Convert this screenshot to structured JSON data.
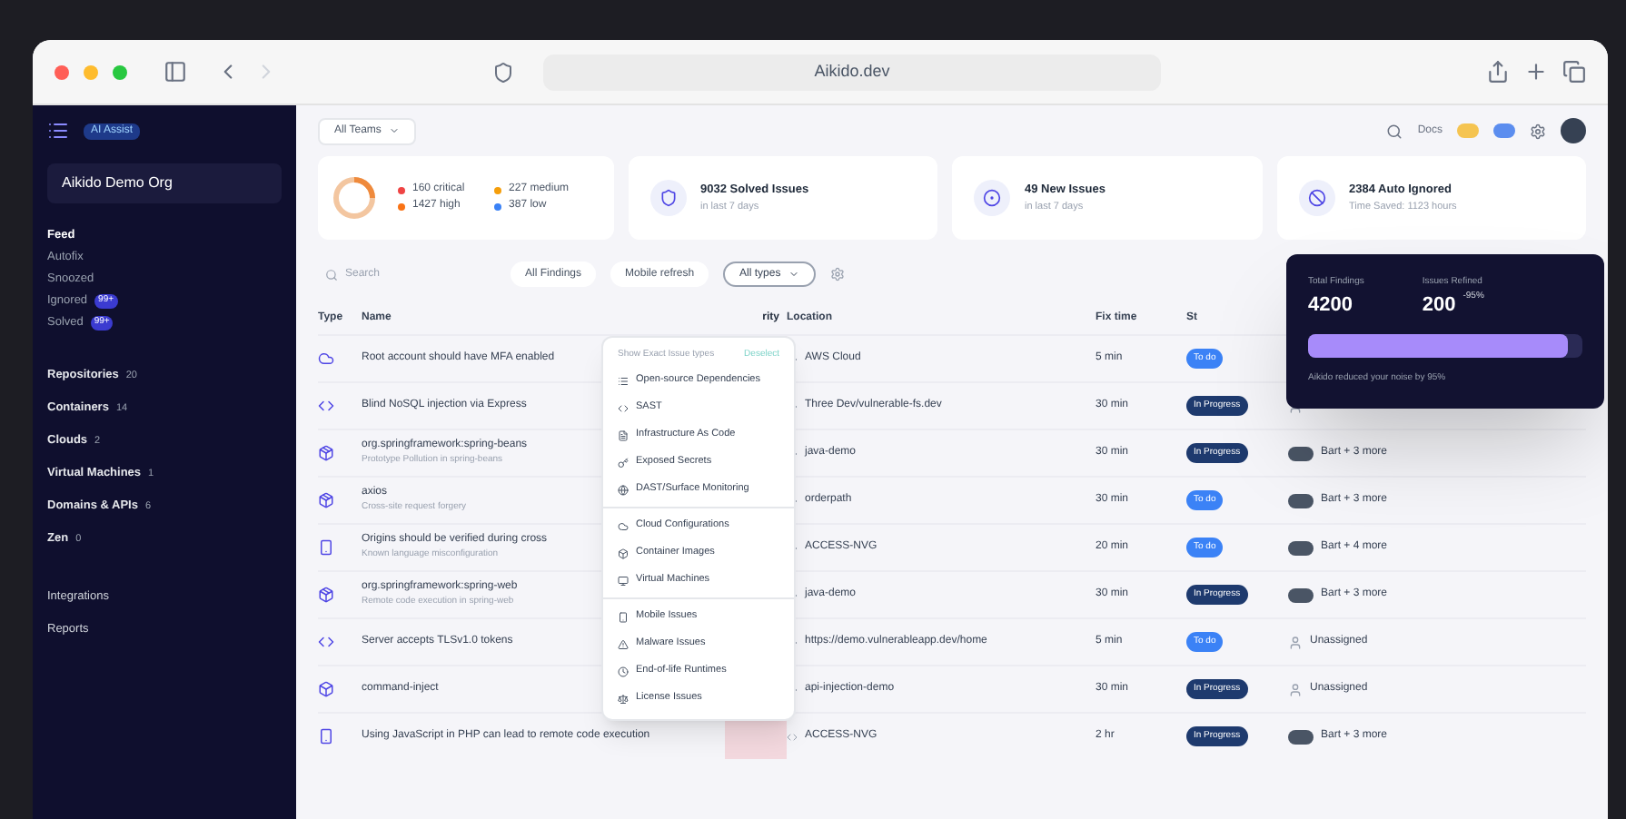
{
  "browser": {
    "address": "Aikido.dev"
  },
  "sidebar": {
    "badge": "AI Assist",
    "org": "Aikido Demo Org",
    "feed": [
      {
        "label": "Feed",
        "selected": true
      },
      {
        "label": "Autofix",
        "selected": false
      },
      {
        "label": "Snoozed",
        "selected": false
      },
      {
        "label": "Ignored",
        "selected": false,
        "count": "99+"
      },
      {
        "label": "Solved",
        "selected": false,
        "count": "99+"
      }
    ],
    "assets": [
      {
        "label": "Repositories",
        "count": "20"
      },
      {
        "label": "Containers",
        "count": "14"
      },
      {
        "label": "Clouds",
        "count": "2"
      },
      {
        "label": "Virtual Machines",
        "count": "1"
      },
      {
        "label": "Domains & APIs",
        "count": "6"
      },
      {
        "label": "Zen",
        "count": "0"
      }
    ],
    "footer": [
      {
        "label": "Integrations"
      },
      {
        "label": "Reports"
      }
    ]
  },
  "header": {
    "team": "All Teams",
    "docs": "Docs"
  },
  "stats": {
    "severities": [
      {
        "label": "160 critical",
        "color": "#ef4444"
      },
      {
        "label": "227 medium",
        "color": "#f59e0b"
      },
      {
        "label": "1427 high",
        "color": "#f97316"
      },
      {
        "label": "387 low",
        "color": "#3b82f6"
      }
    ],
    "cards": [
      {
        "kind": "solved",
        "title": "9032 Solved Issues",
        "subtitle": "in last 7 days"
      },
      {
        "kind": "new",
        "title": "49 New Issues",
        "subtitle": "in last 7 days"
      },
      {
        "kind": "ignored",
        "title": "2384 Auto Ignored",
        "subtitle": "Time Saved: 1123 hours"
      }
    ]
  },
  "filters": {
    "search_placeholder": "Search",
    "chips": [
      {
        "label": "All Findings",
        "selected": false
      },
      {
        "label": "Mobile refresh",
        "selected": false
      },
      {
        "label": "All types",
        "selected": true
      }
    ]
  },
  "table": {
    "columns": [
      "Type",
      "Name",
      "rity",
      "Location",
      "Fix time",
      "St"
    ],
    "rows": [
      {
        "kind": "cloud",
        "name": "Root account should have MFA enabled",
        "location": "AWS Cloud",
        "fix_time": "5 min",
        "status": {
          "kind": "todo",
          "label": "To do"
        },
        "assignee": {
          "kind": "none"
        }
      },
      {
        "kind": "code",
        "name": "Blind NoSQL injection via Express",
        "location": "Three Dev/vulnerable-fs.dev",
        "fix_time": "30 min",
        "status": {
          "kind": "progress",
          "label": "In Progress"
        },
        "assignee": {
          "kind": "none"
        }
      },
      {
        "kind": "dependency",
        "name": "org.springframework:spring-beans",
        "subtitle": "Prototype Pollution in spring-beans",
        "location": "java-demo",
        "fix_time": "30 min",
        "status": {
          "kind": "progress",
          "label": "In Progress"
        },
        "assignee": {
          "kind": "people",
          "label": "Bart + 3 more"
        }
      },
      {
        "kind": "dependency",
        "name": "axios",
        "subtitle": "Cross-site request forgery",
        "location": "orderpath",
        "fix_time": "30 min",
        "status": {
          "kind": "todo",
          "label": "To do"
        },
        "assignee": {
          "kind": "people",
          "label": "Bart + 3 more"
        }
      },
      {
        "kind": "mobile",
        "name": "Origins should be verified during cross",
        "subtitle": "Known language misconfiguration",
        "location": "ACCESS-NVG",
        "fix_time": "20 min",
        "status": {
          "kind": "todo",
          "label": "To do"
        },
        "assignee": {
          "kind": "people",
          "label": "Bart + 4 more"
        }
      },
      {
        "kind": "dependency",
        "name": "org.springframework:spring-web",
        "subtitle": "Remote code execution in spring-web",
        "location": "java-demo",
        "fix_time": "30 min",
        "status": {
          "kind": "progress",
          "label": "In Progress"
        },
        "assignee": {
          "kind": "people",
          "label": "Bart + 3 more"
        }
      },
      {
        "kind": "code",
        "name": "Server accepts TLSv1.0 tokens",
        "location": "https://demo.vulnerableapp.dev/home",
        "fix_time": "5 min",
        "status": {
          "kind": "todo",
          "label": "To do"
        },
        "assignee": {
          "kind": "none",
          "label": "Unassigned"
        }
      },
      {
        "kind": "container",
        "name": "command-inject",
        "location": "api-injection-demo",
        "fix_time": "30 min",
        "status": {
          "kind": "progress",
          "label": "In Progress"
        },
        "assignee": {
          "kind": "none",
          "label": "Unassigned"
        }
      },
      {
        "kind": "mobile",
        "name": "Using JavaScript in PHP can lead to remote code execution",
        "location": "ACCESS-NVG",
        "fix_time": "2 hr",
        "status": {
          "kind": "progress",
          "label": "In Progress"
        },
        "assignee": {
          "kind": "people",
          "label": "Bart + 3 more"
        }
      }
    ]
  },
  "type_menu": {
    "title": "Show Exact Issue types",
    "action": "Deselect",
    "groups": [
      [
        "Open-source Dependencies",
        "SAST",
        "Infrastructure As Code",
        "Exposed Secrets",
        "DAST/Surface Monitoring"
      ],
      [
        "Cloud Configurations",
        "Container Images",
        "Virtual Machines"
      ],
      [
        "Mobile Issues",
        "Malware Issues",
        "End-of-life Runtimes",
        "License Issues"
      ]
    ]
  },
  "noise_card": {
    "total_label": "Total Findings",
    "total": "4200",
    "refined_label": "Issues Refined",
    "refined": "200",
    "reduction": "-95%",
    "caption": "Aikido reduced your noise by 95%",
    "level": 0.95
  }
}
